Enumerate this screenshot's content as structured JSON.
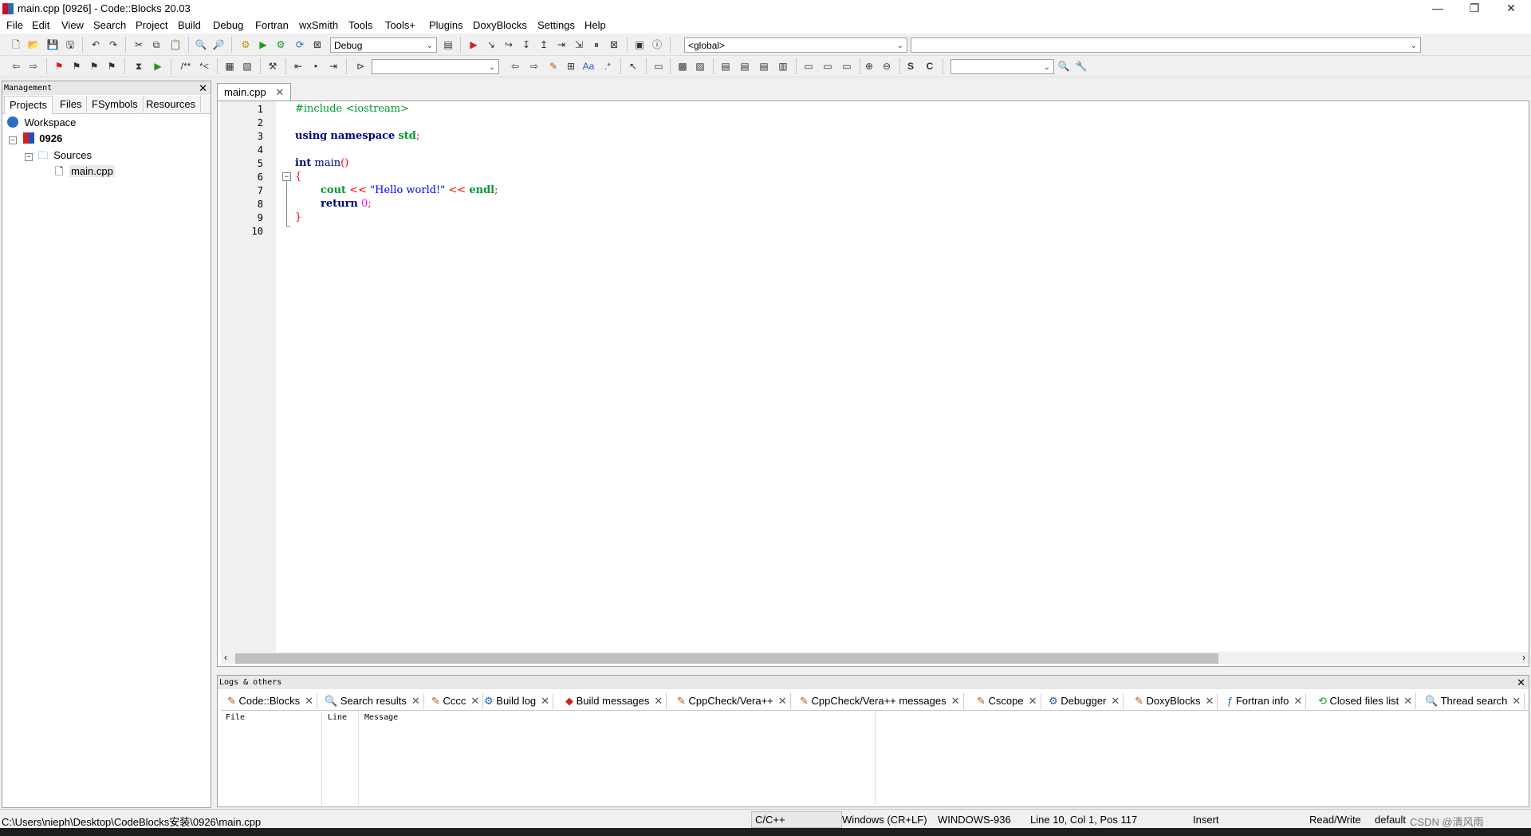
{
  "window": {
    "title": "main.cpp [0926] - Code::Blocks 20.03",
    "buttons": {
      "minimize": "—",
      "maximize": "❐",
      "close": "✕"
    }
  },
  "menu": [
    "File",
    "Edit",
    "View",
    "Search",
    "Project",
    "Build",
    "Debug",
    "Fortran",
    "wxSmith",
    "Tools",
    "Tools+",
    "Plugins",
    "DoxyBlocks",
    "Settings",
    "Help"
  ],
  "toolbar": {
    "build_target": "Debug",
    "scope": "<global>",
    "function": "",
    "search_text": "",
    "search2_text": ""
  },
  "management": {
    "title": "Management",
    "tabs": [
      "Projects",
      "Files",
      "FSymbols",
      "Resources"
    ],
    "active_tab": "Projects",
    "tree": {
      "workspace": "Workspace",
      "project": "0926",
      "folder": "Sources",
      "file": "main.cpp"
    }
  },
  "editor": {
    "tab_label": "main.cpp",
    "line_numbers": [
      "1",
      "2",
      "3",
      "4",
      "5",
      "6",
      "7",
      "8",
      "9",
      "10"
    ],
    "code": {
      "l1": "#include <iostream>",
      "l3_kw1": "using",
      "l3_kw2": "namespace",
      "l3_id": "std",
      "l3_p": ";",
      "l5_kw": "int",
      "l5_id": "main",
      "l5_p": "()",
      "l6": "{",
      "l7_a": "cout",
      "l7_op1": "<<",
      "l7_str": "\"Hello world!\"",
      "l7_op2": "<<",
      "l7_b": "endl",
      "l7_p": ";",
      "l8_kw": "return",
      "l8_num": "0",
      "l8_p": ";",
      "l9": "}"
    }
  },
  "logs": {
    "title": "Logs & others",
    "tabs": [
      "Code::Blocks",
      "Search results",
      "Cccc",
      "Build log",
      "Build messages",
      "CppCheck/Vera++",
      "CppCheck/Vera++ messages",
      "Cscope",
      "Debugger",
      "DoxyBlocks",
      "Fortran info",
      "Closed files list",
      "Thread search"
    ],
    "active_tab": "Build messages",
    "columns": [
      "File",
      "Line",
      "Message"
    ]
  },
  "statusbar": {
    "path": "C:\\Users\\nieph\\Desktop\\CodeBlocks安装\\0926\\main.cpp",
    "language": "C/C++",
    "eol": "Windows (CR+LF)",
    "encoding": "WINDOWS-936",
    "position": "Line 10, Col 1, Pos 117",
    "mode": "Insert",
    "access": "Read/Write",
    "profile": "default",
    "watermark": "CSDN @清风雨"
  }
}
